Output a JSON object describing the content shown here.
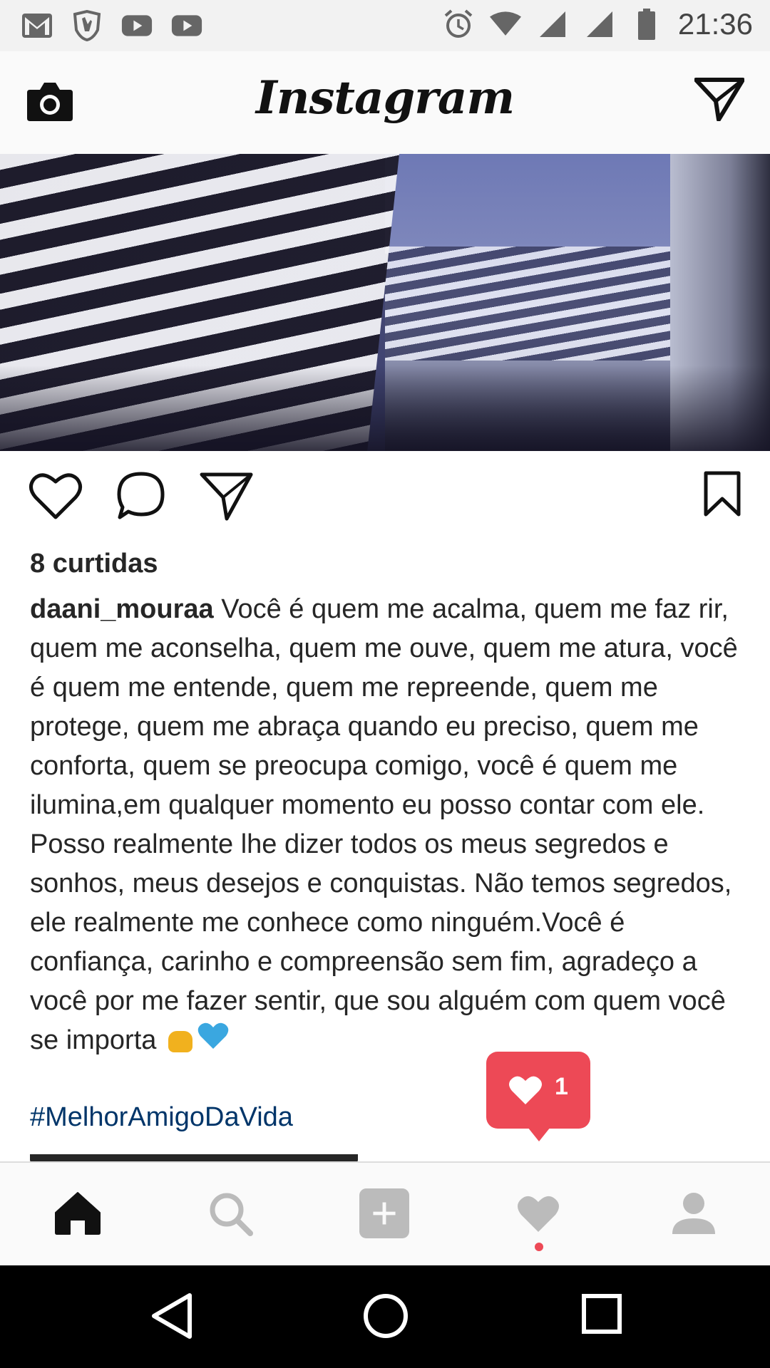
{
  "status_bar": {
    "left_icons": [
      "gmail-icon",
      "hand-shield-icon",
      "youtube-icon",
      "youtube-icon"
    ],
    "right_icons": [
      "alarm-icon",
      "wifi-icon",
      "signal-icon",
      "signal-icon",
      "battery-icon"
    ],
    "time": "21:36"
  },
  "header": {
    "title": "Instagram",
    "left_icon": "camera-icon",
    "right_icon": "direct-message-icon"
  },
  "post": {
    "likes_text": "8 curtidas",
    "username": "daani_mouraa",
    "caption": "Você é quem me acalma, quem me faz rir, quem me aconselha, quem me ouve, quem me atura, você é quem me entende, quem me repreende, quem me protege, quem me abraça quando eu preciso, quem me conforta, quem se preocupa comigo, você é quem me ilumina,em qualquer momento eu posso contar com ele. Posso realmente lhe dizer todos os meus segredos e sonhos, meus desejos e conquistas. Não temos segredos, ele realmente me conhece como ninguém.Você é confiança, carinho e compreensão sem fim, agradeço a você por me fazer sentir, que sou alguém com quem você se importa",
    "caption_emojis": [
      "fist-emoji",
      "blue-heart-emoji"
    ],
    "hashtag": "#MelhorAmigoDaVida",
    "actions": [
      "heart-icon",
      "comment-icon",
      "share-icon",
      "bookmark-icon"
    ]
  },
  "notification": {
    "icon": "heart-icon",
    "count": "1",
    "color": "#ed4956"
  },
  "bottom_nav": {
    "items": [
      "home-icon",
      "search-icon",
      "add-post-icon",
      "activity-heart-icon",
      "profile-icon"
    ],
    "active": "home"
  },
  "system_nav": [
    "back-icon",
    "home-circle-icon",
    "recents-icon"
  ]
}
